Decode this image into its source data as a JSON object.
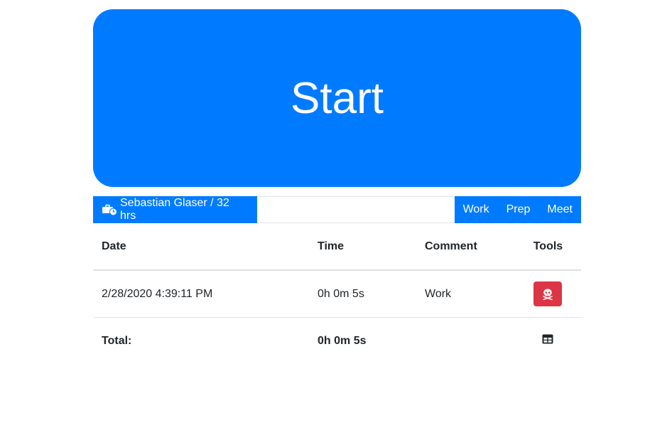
{
  "start": {
    "label": "Start"
  },
  "toolbar": {
    "user_label": "Sebastian Glaser / 32 hrs",
    "user_icon": "business-time-icon",
    "comment_value": "",
    "categories": [
      "Work",
      "Prep",
      "Meet"
    ]
  },
  "table": {
    "headers": {
      "date": "Date",
      "time": "Time",
      "comment": "Comment",
      "tools": "Tools"
    },
    "rows": [
      {
        "date": "2/28/2020 4:39:11 PM",
        "time": "0h 0m 5s",
        "comment": "Work",
        "tool_icon": "skull-crossbones-icon"
      }
    ],
    "total": {
      "label": "Total:",
      "time": "0h 0m 5s",
      "tool_icon": "table-icon"
    }
  },
  "colors": {
    "primary": "#007bff",
    "danger": "#dc3545"
  }
}
